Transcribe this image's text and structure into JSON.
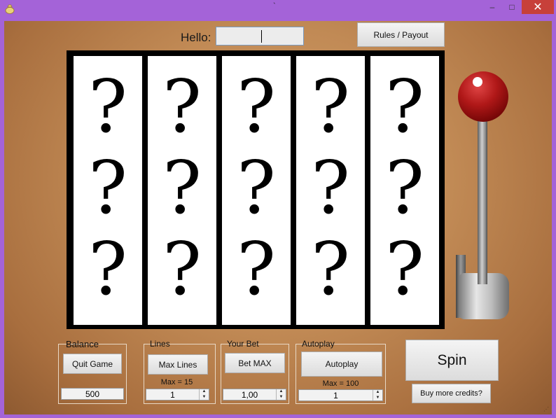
{
  "window": {
    "title": "`",
    "controls": {
      "minimize": "‒",
      "maximize": "□",
      "close": "✕"
    }
  },
  "header": {
    "hello_label": "Hello:",
    "name_value": "",
    "rules_button": "Rules / Payout"
  },
  "reels": {
    "symbol": "?",
    "columns": [
      [
        "?",
        "?",
        "?"
      ],
      [
        "?",
        "?",
        "?"
      ],
      [
        "?",
        "?",
        "?"
      ],
      [
        "?",
        "?",
        "?"
      ],
      [
        "?",
        "?",
        "?"
      ]
    ]
  },
  "balance": {
    "title": "Balance",
    "quit_button": "Quit Game",
    "value": "500"
  },
  "lines": {
    "title": "Lines",
    "max_button": "Max Lines",
    "max_label": "Max = 15",
    "value": "1"
  },
  "bet": {
    "title": "Your Bet",
    "max_button": "Bet MAX",
    "value": "1,00"
  },
  "autoplay": {
    "title": "Autoplay",
    "button": "Autoplay",
    "max_label": "Max = 100",
    "value": "1"
  },
  "actions": {
    "spin": "Spin",
    "buy_credits": "Buy more credits?"
  },
  "colors": {
    "titlebar": "#a463d8",
    "close_button": "#c7403a",
    "felt": "#c18a55",
    "lever_ball": "#b01818"
  }
}
